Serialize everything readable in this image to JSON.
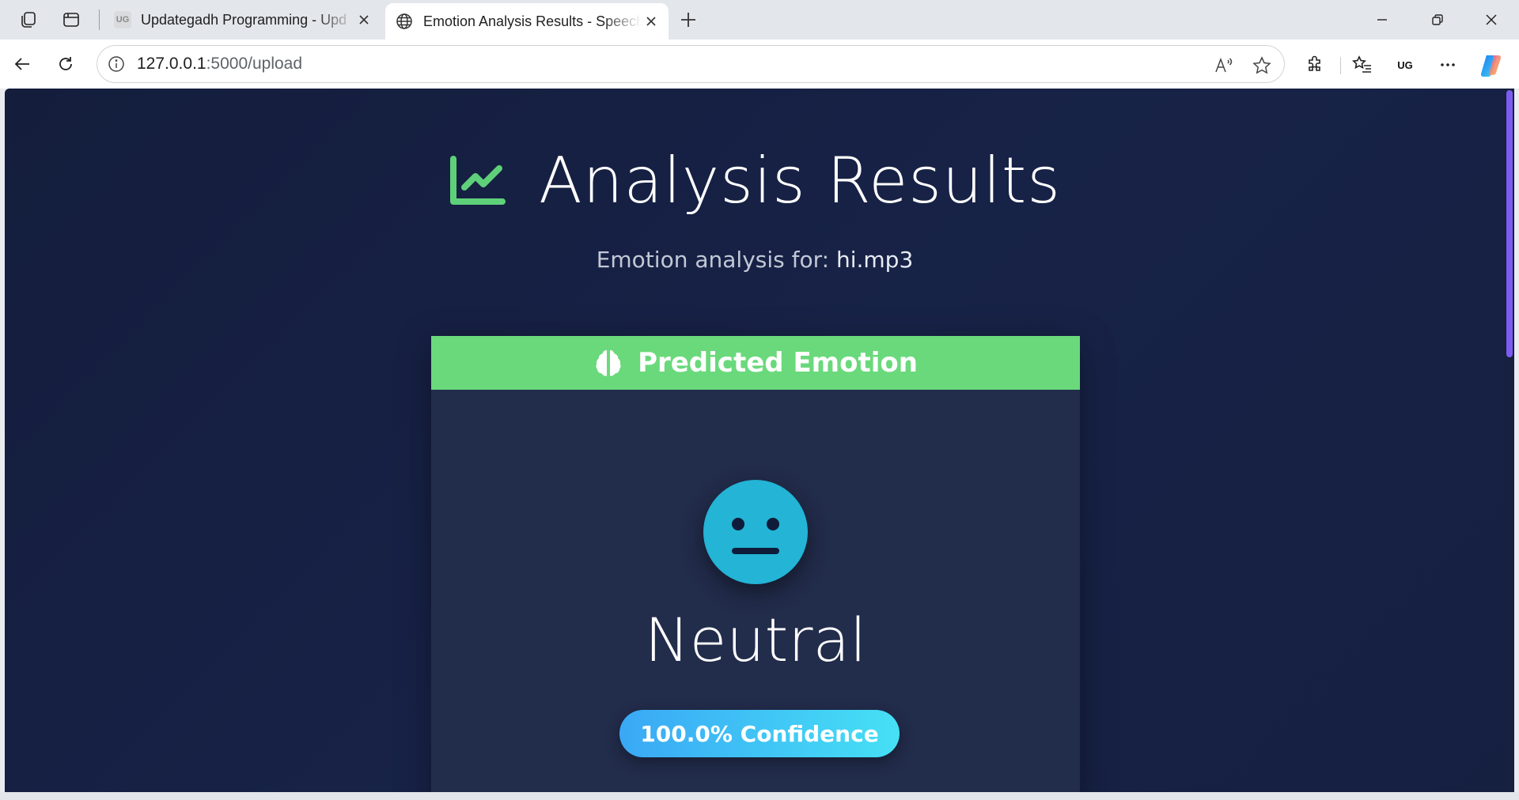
{
  "browser": {
    "tabs": [
      {
        "title": "Updategadh Programming - Upd",
        "favicon": "ug-logo-icon",
        "active": false
      },
      {
        "title": "Emotion Analysis Results - Speech",
        "favicon": "globe-icon",
        "active": true
      }
    ],
    "url_host": "127.0.0.1",
    "url_rest": ":5000/upload",
    "extension_badge": "UG"
  },
  "page": {
    "title": "Analysis Results",
    "subtitle_prefix": "Emotion analysis for:",
    "filename": "hi.mp3",
    "card": {
      "header_label": "Predicted Emotion",
      "emotion": "Neutral",
      "confidence_label": "100.0% Confidence",
      "confidence": 100.0
    }
  },
  "colors": {
    "page_bg": "#151f42",
    "card_bg": "#222c4b",
    "header_green": "#6ad97b",
    "face_blue": "#23b4d6",
    "badge_gradient_start": "#3aa8f5",
    "badge_gradient_end": "#46e0f5",
    "scroll_thumb": "#7c5cf0"
  }
}
